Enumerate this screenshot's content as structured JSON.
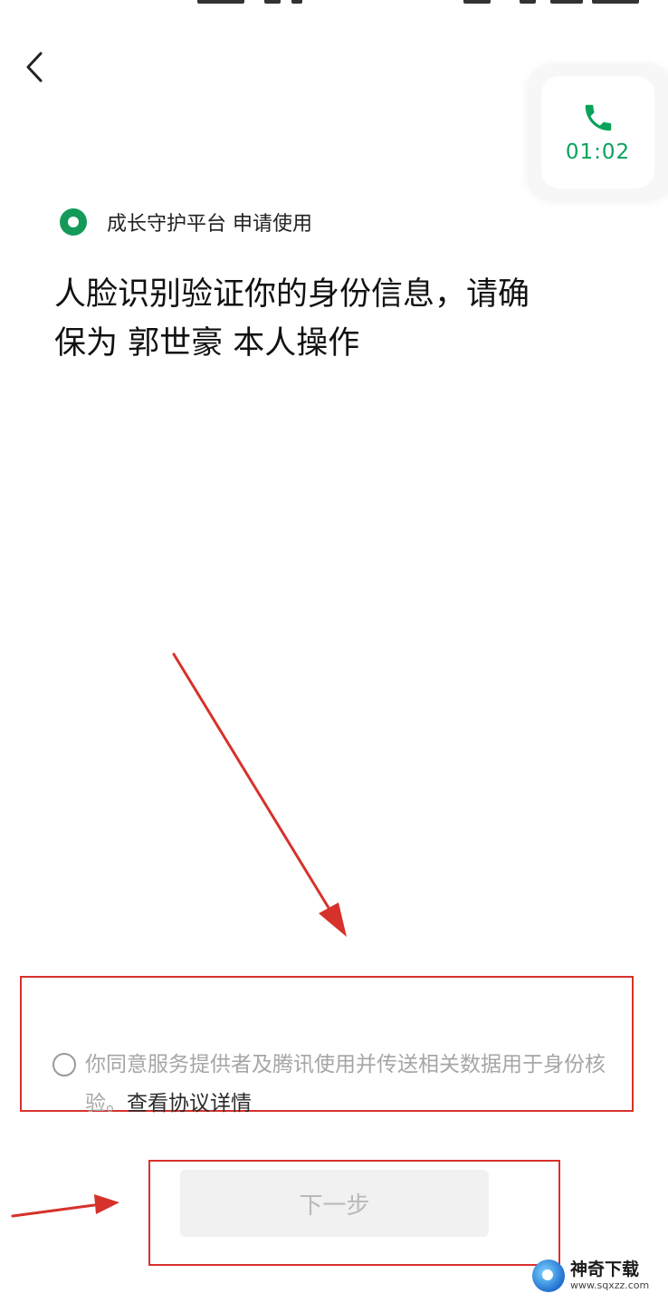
{
  "call": {
    "timer": "01:02"
  },
  "app": {
    "requester": "成长守护平台 申请使用"
  },
  "headline": {
    "line1": "人脸识别验证你的身份信息，请确",
    "line2": "保为 郭世豪 本人操作"
  },
  "agreement": {
    "text": "你同意服务提供者及腾讯使用并传送相关数据用于身份核验。",
    "link": "查看协议详情"
  },
  "next_button": {
    "label": "下一步"
  },
  "watermark": {
    "name": "神奇下载",
    "url": "www.sqxzz.com"
  },
  "colors": {
    "accent_green": "#07a35a",
    "annotation_red": "#d7312b"
  }
}
